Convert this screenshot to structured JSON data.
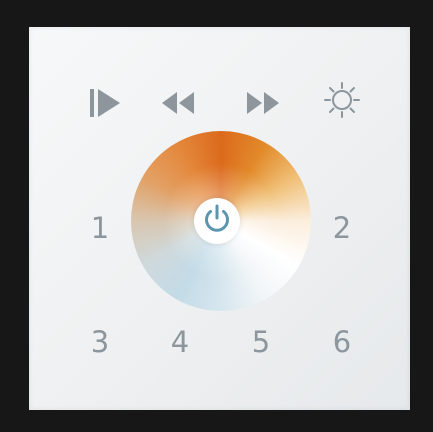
{
  "controls": {
    "play_icon": "play-icon",
    "rewind_icon": "rewind-icon",
    "fast_forward_icon": "fast-forward-icon",
    "brightness_icon": "sun-icon",
    "power_icon": "power-icon"
  },
  "scenes": [
    "1",
    "2",
    "3",
    "4",
    "5",
    "6"
  ],
  "colors": {
    "icon": "#8c969c",
    "panel": "#f1f3f4",
    "frame": "#171717",
    "wheel_warm": "#dc6a1c",
    "wheel_cool": "#c3dbe7",
    "power_icon": "#5c95ae"
  }
}
